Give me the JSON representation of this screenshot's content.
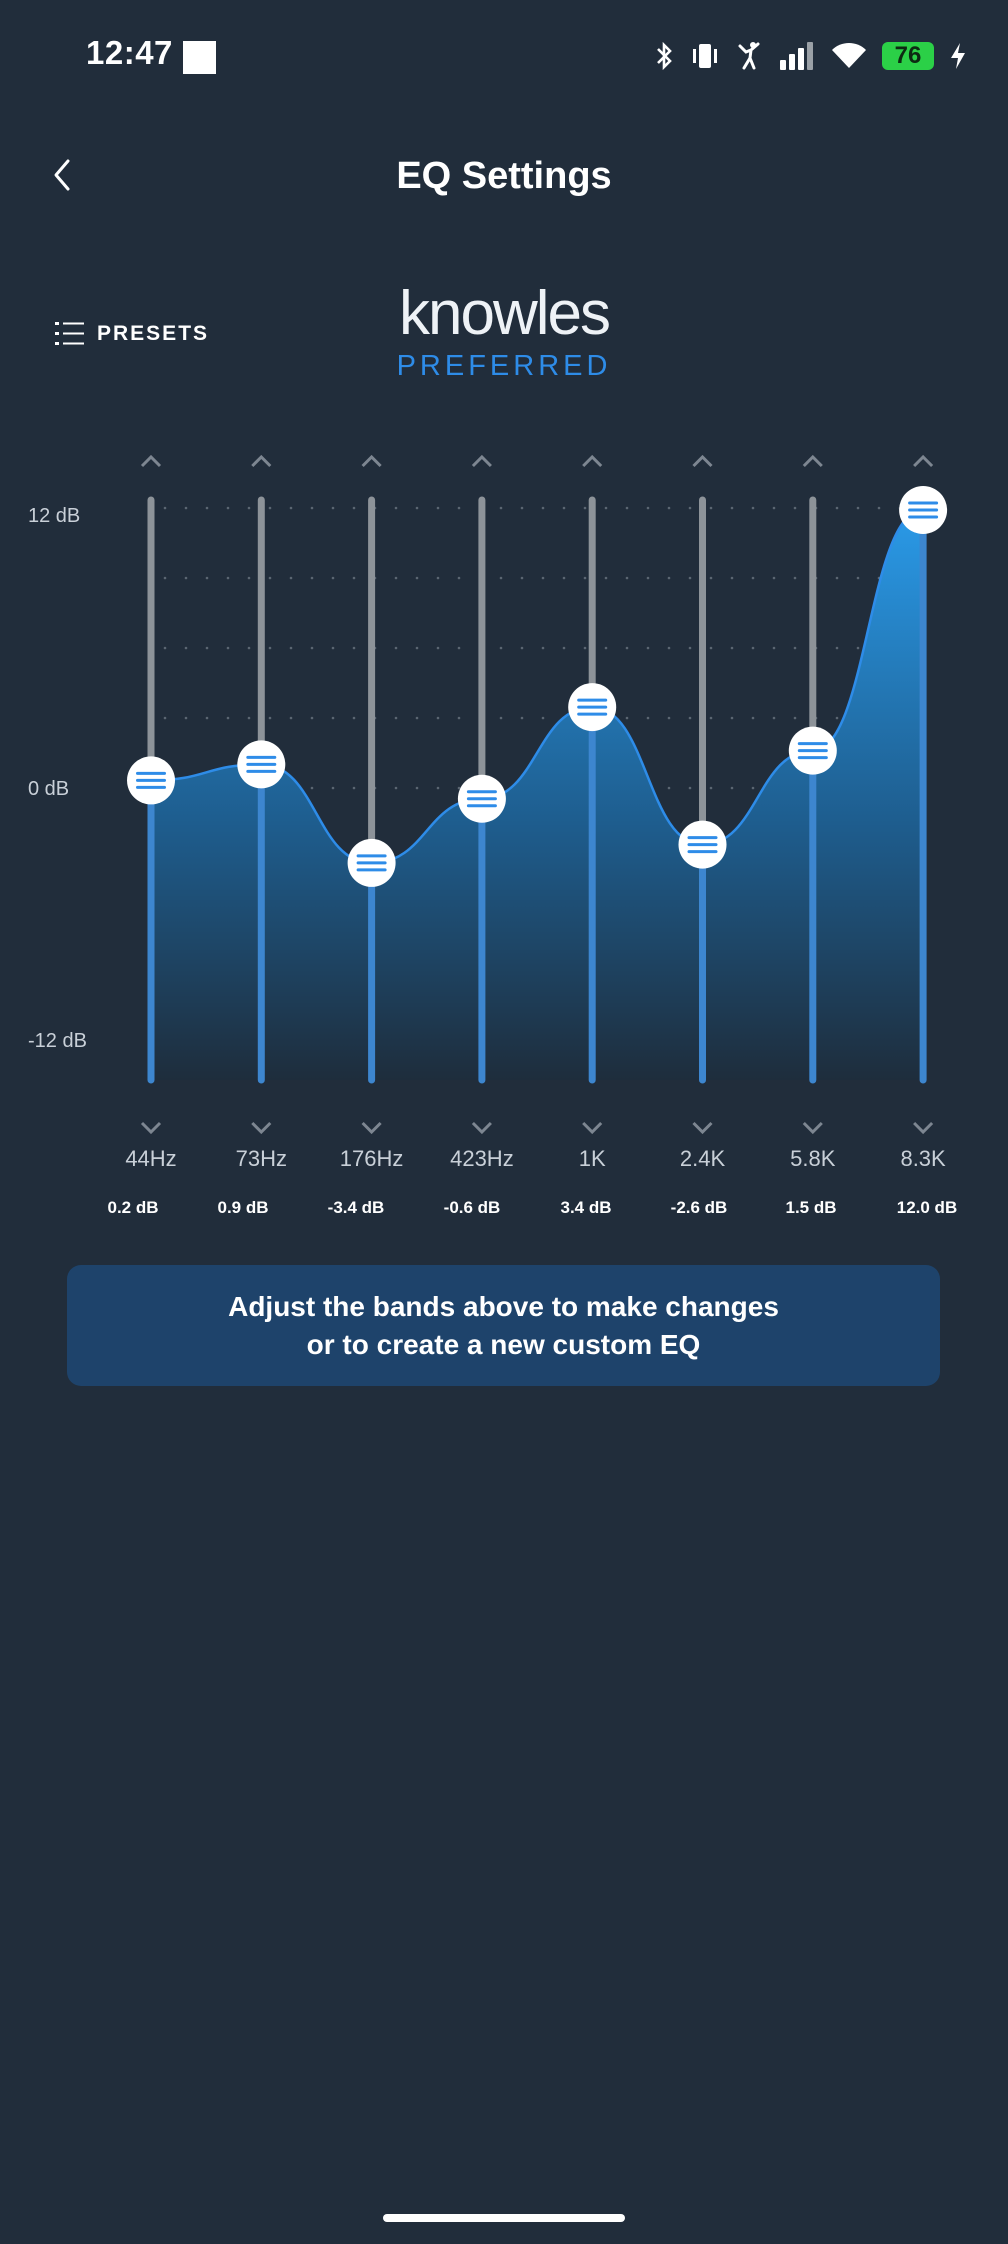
{
  "status_bar": {
    "time": "12:47",
    "battery": "76",
    "icons": [
      "bluetooth-icon",
      "vibrate-icon",
      "activity-icon",
      "signal-icon",
      "wifi-icon",
      "battery-icon",
      "charging-icon"
    ]
  },
  "header": {
    "title": "EQ Settings",
    "back_icon": "chevron-left-icon"
  },
  "presets": {
    "label": "PRESETS",
    "icon": "list-icon"
  },
  "preset_brand": {
    "name": "knowles",
    "subtitle": "PREFERRED"
  },
  "eq": {
    "y_labels": {
      "top": "12 dB",
      "mid": "0 dB",
      "bottom": "-12 dB"
    },
    "bands": [
      {
        "freq": "44Hz",
        "db_label": "0.2 dB",
        "value": 0.2
      },
      {
        "freq": "73Hz",
        "db_label": "0.9 dB",
        "value": 0.9
      },
      {
        "freq": "176Hz",
        "db_label": "-3.4 dB",
        "value": -3.4
      },
      {
        "freq": "423Hz",
        "db_label": "-0.6 dB",
        "value": -0.6
      },
      {
        "freq": "1K",
        "db_label": "3.4 dB",
        "value": 3.4
      },
      {
        "freq": "2.4K",
        "db_label": "-2.6 dB",
        "value": -2.6
      },
      {
        "freq": "5.8K",
        "db_label": "1.5 dB",
        "value": 1.5
      },
      {
        "freq": "8.3K",
        "db_label": "12.0 dB",
        "value": 12.0
      }
    ],
    "accent_color": "#2e8ce8",
    "track_color": "#8d9399"
  },
  "info": {
    "line1": "Adjust the bands above to make changes",
    "line2": "or to create a new custom EQ"
  }
}
